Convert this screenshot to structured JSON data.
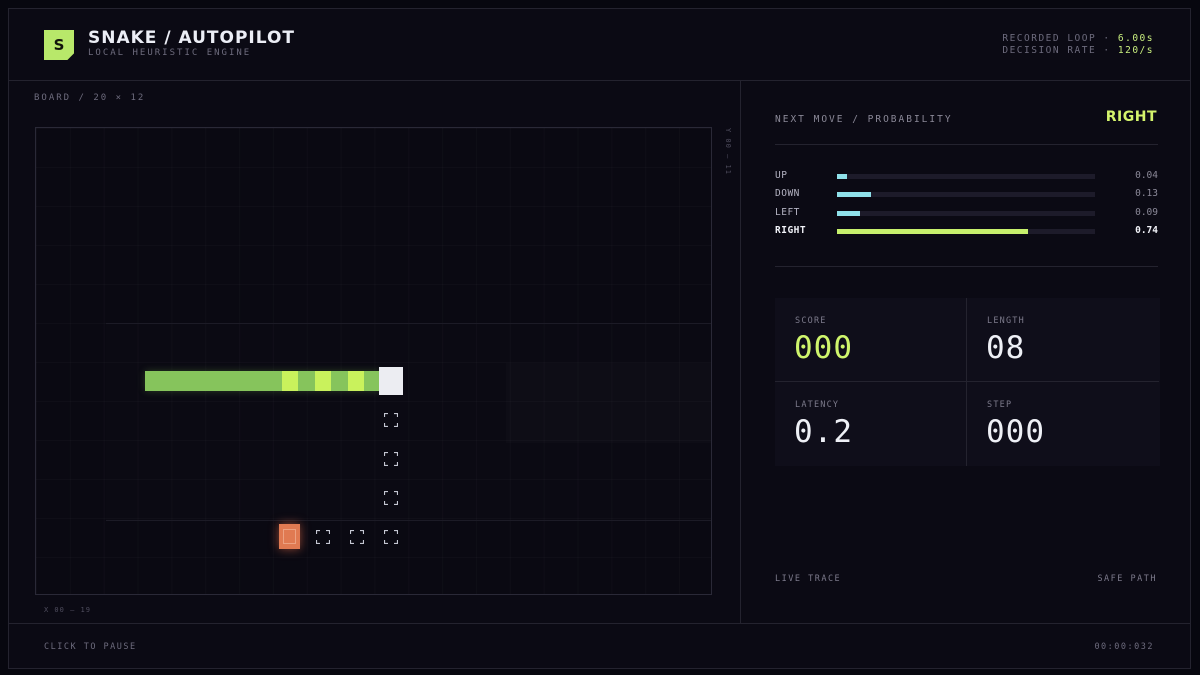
{
  "header": {
    "logo_letter": "S",
    "title": "SNAKE / AUTOPILOT",
    "subtitle": "LOCAL HEURISTIC ENGINE",
    "recorded_loop_label": "RECORDED LOOP ·",
    "recorded_loop_value": "6.00s",
    "decision_rate_label": "DECISION RATE ·",
    "decision_rate_value": "120/s"
  },
  "board": {
    "label": "BOARD / 20 × 12",
    "axis_y": "Y 00 — 11",
    "axis_x": "X 00 — 19"
  },
  "next_move": {
    "label": "NEXT MOVE / PROBABILITY",
    "value": "RIGHT",
    "probabilities": [
      {
        "label": "UP",
        "value": "0.04",
        "fraction": 0.04
      },
      {
        "label": "DOWN",
        "value": "0.13",
        "fraction": 0.13
      },
      {
        "label": "LEFT",
        "value": "0.09",
        "fraction": 0.09
      },
      {
        "label": "RIGHT",
        "value": "0.74",
        "fraction": 0.74
      }
    ]
  },
  "stats": {
    "score_label": "SCORE",
    "score_value": "000",
    "length_label": "LENGTH",
    "length_value": "08",
    "latency_label": "LATENCY",
    "latency_value": "0.2",
    "step_label": "STEP",
    "step_value": "000"
  },
  "panel_footer": {
    "left": "LIVE TRACE",
    "right": "SAFE PATH"
  },
  "footer": {
    "left": "CLICK TO PAUSE",
    "right": "00:00:032"
  },
  "colors": {
    "accent": "#c9f25c",
    "snake_body": "#86c45c",
    "snake_head": "#ecedf2",
    "food": "#e07a52",
    "prob_bar": "#8fe1ea"
  }
}
